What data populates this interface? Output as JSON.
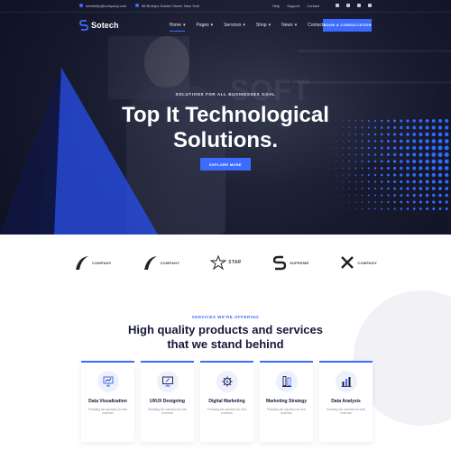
{
  "topbar": {
    "email": "needhelp@company.com",
    "address": "88 Broklyn Golden Street. New York",
    "links": [
      "Help",
      "Support",
      "Contact"
    ],
    "social_icons": [
      "twitter-icon",
      "facebook-icon",
      "pinterest-icon",
      "instagram-icon"
    ]
  },
  "brand": {
    "name": "Sotech"
  },
  "nav": {
    "items": [
      {
        "label": "Home",
        "has_dropdown": true,
        "active": true
      },
      {
        "label": "Pages",
        "has_dropdown": true,
        "active": false
      },
      {
        "label": "Services",
        "has_dropdown": true,
        "active": false
      },
      {
        "label": "Shop",
        "has_dropdown": true,
        "active": false
      },
      {
        "label": "News",
        "has_dropdown": true,
        "active": false
      },
      {
        "label": "Contact",
        "has_dropdown": false,
        "active": false
      }
    ],
    "cta_label": "BOOK A CONSULTATION"
  },
  "hero": {
    "eyebrow": "SOLUTIONS FOR ALL BUSINESSES GOAL",
    "watermark": "SOFT",
    "title_line1": "Top It Technological",
    "title_line2": "Solutions.",
    "button_label": "EXPLORE MORE"
  },
  "brands": [
    {
      "name": "COMPANY",
      "icon": "arc-logo-icon"
    },
    {
      "name": "COMPANY",
      "icon": "arc-logo-icon"
    },
    {
      "name": "STAR",
      "icon": "star-logo-icon"
    },
    {
      "name": "SUPREME",
      "icon": "s-logo-icon"
    },
    {
      "name": "COMPANY",
      "icon": "x-logo-icon"
    }
  ],
  "services": {
    "eyebrow": "SERVICES WE'RE OFFERING",
    "title_line1": "High quality products and services",
    "title_line2": "that we stand behind",
    "cards": [
      {
        "title": "Data Visualization",
        "text": "Providing the solutions for tech business",
        "icon": "presentation-chart-icon"
      },
      {
        "title": "UI/UX Designing",
        "text": "Providing the solutions for tech business",
        "icon": "design-monitor-icon"
      },
      {
        "title": "Digital Marketing",
        "text": "Providing the solutions for tech business",
        "icon": "gear-icon"
      },
      {
        "title": "Marketing Strategy",
        "text": "Providing the solutions for tech business",
        "icon": "strategy-icon"
      },
      {
        "title": "Data Analysis",
        "text": "Providing the solutions for tech business",
        "icon": "bar-chart-icon"
      }
    ]
  },
  "colors": {
    "accent": "#3c6cff",
    "dark": "#15173a",
    "hero_bg": "#1b1d33"
  }
}
